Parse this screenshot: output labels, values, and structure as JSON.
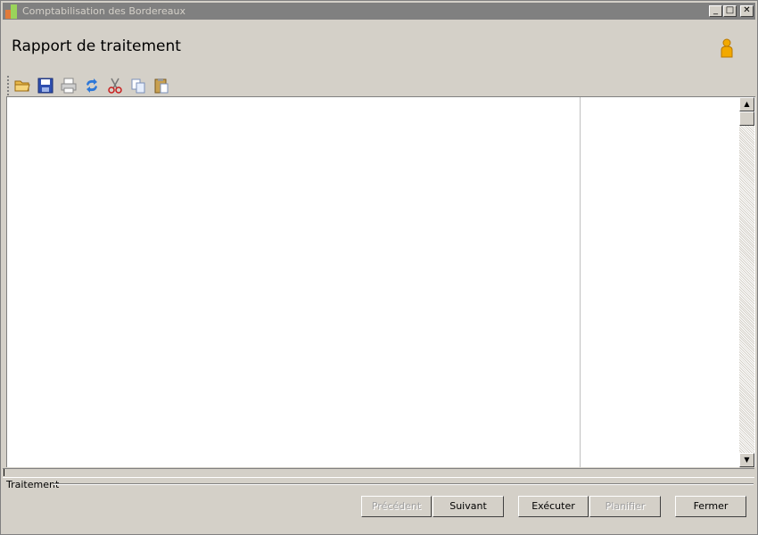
{
  "window": {
    "title": "Comptabilisation des Bordereaux"
  },
  "page": {
    "heading": "Rapport de traitement"
  },
  "toolbar": {
    "icons": [
      "open-folder-icon",
      "save-icon",
      "print-icon",
      "refresh-icon",
      "cut-icon",
      "copy-icon",
      "paste-icon"
    ]
  },
  "group": {
    "label": "Traitement"
  },
  "buttons": {
    "previous": "Précédent",
    "next": "Suivant",
    "execute": "Exécuter",
    "schedule": "Planifier",
    "close": "Fermer"
  },
  "colors": {
    "titlebar": "#808080",
    "face": "#d4d0c8",
    "content": "#ffffff"
  }
}
